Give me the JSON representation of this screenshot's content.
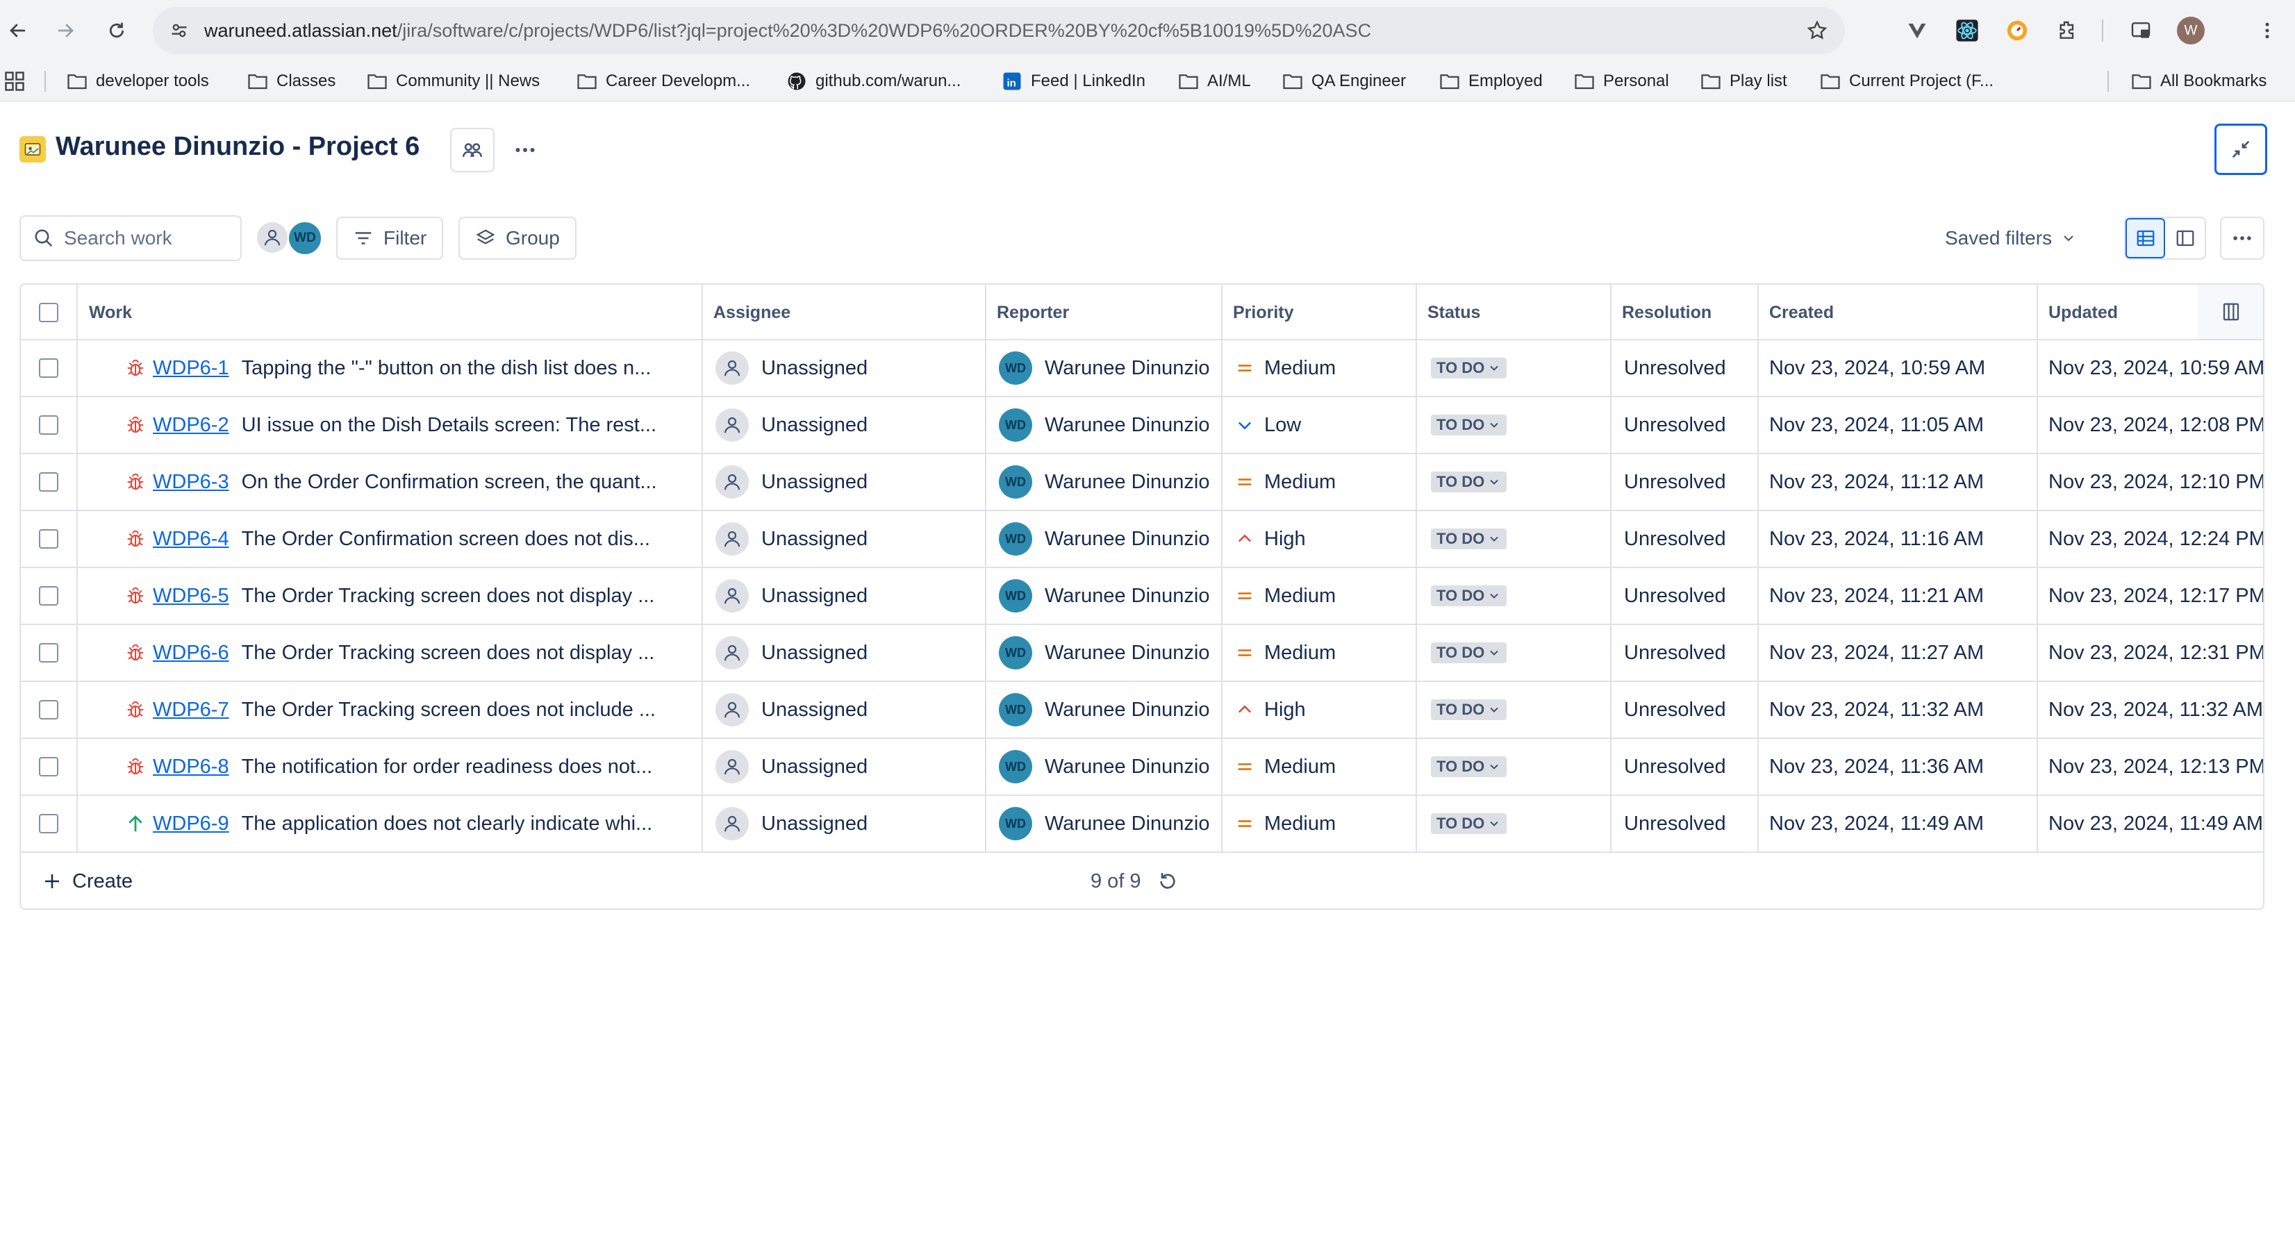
{
  "browser": {
    "url_domain": "waruneed.atlassian.net",
    "url_path": "/jira/software/c/projects/WDP6/list?jql=project%20%3D%20WDP6%20ORDER%20BY%20cf%5B10019%5D%20ASC",
    "profile_initial": "W",
    "bookmarks": [
      {
        "label": "developer tools",
        "icon": "folder-icon"
      },
      {
        "label": "Classes",
        "icon": "folder-icon"
      },
      {
        "label": "Community || News",
        "icon": "folder-icon"
      },
      {
        "label": "Career Developm...",
        "icon": "folder-icon"
      },
      {
        "label": "github.com/warun...",
        "icon": "github-icon"
      },
      {
        "label": "Feed | LinkedIn",
        "icon": "linkedin-icon"
      },
      {
        "label": "AI/ML",
        "icon": "folder-icon"
      },
      {
        "label": "QA Engineer",
        "icon": "folder-icon"
      },
      {
        "label": "Employed",
        "icon": "folder-icon"
      },
      {
        "label": "Personal",
        "icon": "folder-icon"
      },
      {
        "label": "Play list",
        "icon": "folder-icon"
      },
      {
        "label": "Current Project (F...",
        "icon": "folder-icon"
      }
    ],
    "all_bookmarks": "All Bookmarks"
  },
  "header": {
    "project_title": "Warunee Dinunzio - Project 6"
  },
  "toolbar": {
    "search_placeholder": "Search work",
    "avatar_initials": "WD",
    "filter_label": "Filter",
    "group_label": "Group",
    "saved_filters_label": "Saved filters"
  },
  "table": {
    "columns": [
      "Work",
      "Assignee",
      "Reporter",
      "Priority",
      "Status",
      "Resolution",
      "Created",
      "Updated"
    ],
    "rows": [
      {
        "type": "bug",
        "key": "WDP6-1",
        "summary": "Tapping the \"-\" button on the dish list does n...",
        "assignee": "Unassigned",
        "reporter_initials": "WD",
        "reporter": "Warunee Dinunzio",
        "priority": "Medium",
        "status": "TO DO",
        "resolution": "Unresolved",
        "created": "Nov 23, 2024, 10:59 AM",
        "updated": "Nov 23, 2024, 10:59 AM"
      },
      {
        "type": "bug",
        "key": "WDP6-2",
        "summary": "UI issue on the Dish Details screen: The rest...",
        "assignee": "Unassigned",
        "reporter_initials": "WD",
        "reporter": "Warunee Dinunzio",
        "priority": "Low",
        "status": "TO DO",
        "resolution": "Unresolved",
        "created": "Nov 23, 2024, 11:05 AM",
        "updated": "Nov 23, 2024, 12:08 PM"
      },
      {
        "type": "bug",
        "key": "WDP6-3",
        "summary": "On the Order Confirmation screen, the quant...",
        "assignee": "Unassigned",
        "reporter_initials": "WD",
        "reporter": "Warunee Dinunzio",
        "priority": "Medium",
        "status": "TO DO",
        "resolution": "Unresolved",
        "created": "Nov 23, 2024, 11:12 AM",
        "updated": "Nov 23, 2024, 12:10 PM"
      },
      {
        "type": "bug",
        "key": "WDP6-4",
        "summary": "The Order Confirmation screen does not dis...",
        "assignee": "Unassigned",
        "reporter_initials": "WD",
        "reporter": "Warunee Dinunzio",
        "priority": "High",
        "status": "TO DO",
        "resolution": "Unresolved",
        "created": "Nov 23, 2024, 11:16 AM",
        "updated": "Nov 23, 2024, 12:24 PM"
      },
      {
        "type": "bug",
        "key": "WDP6-5",
        "summary": "The Order Tracking screen does not display ...",
        "assignee": "Unassigned",
        "reporter_initials": "WD",
        "reporter": "Warunee Dinunzio",
        "priority": "Medium",
        "status": "TO DO",
        "resolution": "Unresolved",
        "created": "Nov 23, 2024, 11:21 AM",
        "updated": "Nov 23, 2024, 12:17 PM"
      },
      {
        "type": "bug",
        "key": "WDP6-6",
        "summary": "The Order Tracking screen does not display ...",
        "assignee": "Unassigned",
        "reporter_initials": "WD",
        "reporter": "Warunee Dinunzio",
        "priority": "Medium",
        "status": "TO DO",
        "resolution": "Unresolved",
        "created": "Nov 23, 2024, 11:27 AM",
        "updated": "Nov 23, 2024, 12:31 PM"
      },
      {
        "type": "bug",
        "key": "WDP6-7",
        "summary": "The Order Tracking screen does not include ...",
        "assignee": "Unassigned",
        "reporter_initials": "WD",
        "reporter": "Warunee Dinunzio",
        "priority": "High",
        "status": "TO DO",
        "resolution": "Unresolved",
        "created": "Nov 23, 2024, 11:32 AM",
        "updated": "Nov 23, 2024, 11:32 AM"
      },
      {
        "type": "bug",
        "key": "WDP6-8",
        "summary": "The notification for order readiness does not...",
        "assignee": "Unassigned",
        "reporter_initials": "WD",
        "reporter": "Warunee Dinunzio",
        "priority": "Medium",
        "status": "TO DO",
        "resolution": "Unresolved",
        "created": "Nov 23, 2024, 11:36 AM",
        "updated": "Nov 23, 2024, 12:13 PM"
      },
      {
        "type": "improvement",
        "key": "WDP6-9",
        "summary": "The application does not clearly indicate whi...",
        "assignee": "Unassigned",
        "reporter_initials": "WD",
        "reporter": "Warunee Dinunzio",
        "priority": "Medium",
        "status": "TO DO",
        "resolution": "Unresolved",
        "created": "Nov 23, 2024, 11:49 AM",
        "updated": "Nov 23, 2024, 11:49 AM"
      }
    ],
    "create_label": "Create",
    "count_label": "9 of 9"
  },
  "colors": {
    "bug": "#e2483d",
    "improvement": "#22a06b",
    "priority_medium": "#e06c00",
    "priority_high": "#e2483d",
    "priority_low": "#0c66e4",
    "link": "#0c66e4"
  }
}
